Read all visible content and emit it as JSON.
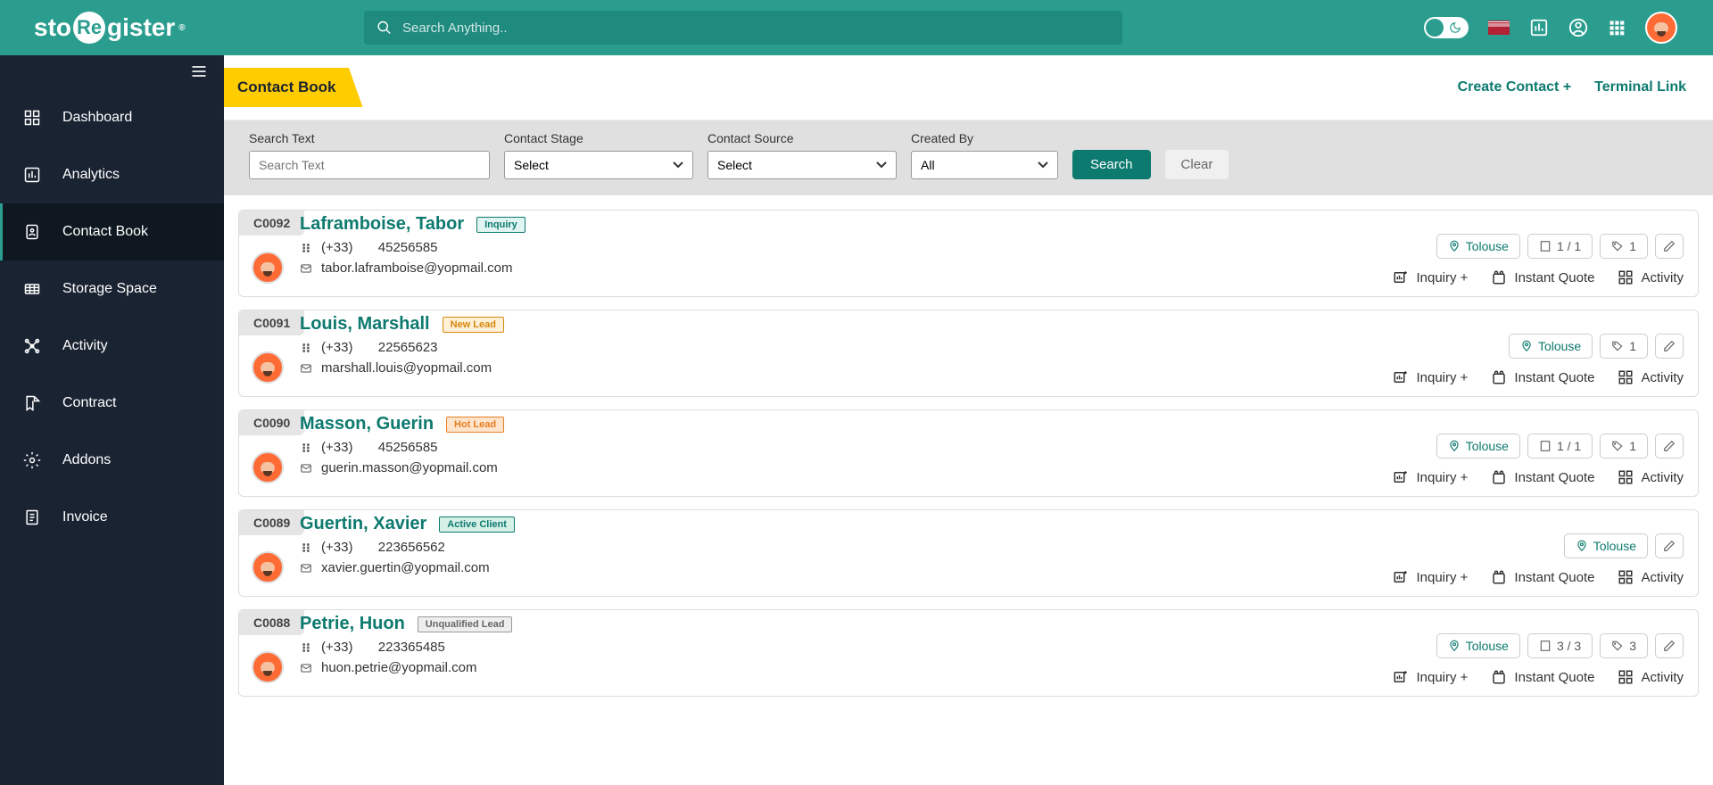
{
  "header": {
    "logo_pre": "sto",
    "logo_mid": "Re",
    "logo_post": "gister",
    "search_placeholder": "Search Anything.."
  },
  "sidebar": {
    "items": [
      {
        "label": "Dashboard",
        "icon": "dashboard-icon"
      },
      {
        "label": "Analytics",
        "icon": "analytics-icon"
      },
      {
        "label": "Contact Book",
        "icon": "contact-icon"
      },
      {
        "label": "Storage Space",
        "icon": "storage-icon"
      },
      {
        "label": "Activity",
        "icon": "activity-icon"
      },
      {
        "label": "Contract",
        "icon": "contract-icon"
      },
      {
        "label": "Addons",
        "icon": "addons-icon"
      },
      {
        "label": "Invoice",
        "icon": "invoice-icon"
      }
    ]
  },
  "page": {
    "title": "Contact Book",
    "create_link": "Create Contact +",
    "terminal_link": "Terminal Link"
  },
  "filters": {
    "search_label": "Search Text",
    "search_placeholder": "Search Text",
    "stage_label": "Contact Stage",
    "stage_value": "Select",
    "source_label": "Contact Source",
    "source_value": "Select",
    "created_label": "Created By",
    "created_value": "All",
    "search_btn": "Search",
    "clear_btn": "Clear"
  },
  "action_labels": {
    "inquiry": "Inquiry +",
    "quote": "Instant Quote",
    "activity": "Activity"
  },
  "contacts": [
    {
      "id": "C0092",
      "name": "Laframboise, Tabor",
      "stage": "Inquiry",
      "stage_class": "b-inquiry",
      "dial": "(+33)",
      "phone": "45256585",
      "email": "tabor.laframboise@yopmail.com",
      "chips": [
        {
          "t": "loc",
          "text": "Tolouse"
        },
        {
          "t": "building",
          "text": "1 / 1"
        },
        {
          "t": "tag",
          "text": "1"
        },
        {
          "t": "edit"
        }
      ]
    },
    {
      "id": "C0091",
      "name": "Louis, Marshall",
      "stage": "New Lead",
      "stage_class": "b-newlead",
      "dial": "(+33)",
      "phone": "22565623",
      "email": "marshall.louis@yopmail.com",
      "chips": [
        {
          "t": "loc",
          "text": "Tolouse"
        },
        {
          "t": "tag",
          "text": "1"
        },
        {
          "t": "edit"
        }
      ]
    },
    {
      "id": "C0090",
      "name": "Masson, Guerin",
      "stage": "Hot Lead",
      "stage_class": "b-hotlead",
      "dial": "(+33)",
      "phone": "45256585",
      "email": "guerin.masson@yopmail.com",
      "chips": [
        {
          "t": "loc",
          "text": "Tolouse"
        },
        {
          "t": "building",
          "text": "1 / 1"
        },
        {
          "t": "tag",
          "text": "1"
        },
        {
          "t": "edit"
        }
      ]
    },
    {
      "id": "C0089",
      "name": "Guertin, Xavier",
      "stage": "Active Client",
      "stage_class": "b-active",
      "dial": "(+33)",
      "phone": "223656562",
      "email": "xavier.guertin@yopmail.com",
      "chips": [
        {
          "t": "loc",
          "text": "Tolouse"
        },
        {
          "t": "edit"
        }
      ]
    },
    {
      "id": "C0088",
      "name": "Petrie, Huon",
      "stage": "Unqualified Lead",
      "stage_class": "b-unqual",
      "dial": "(+33)",
      "phone": "223365485",
      "email": "huon.petrie@yopmail.com",
      "chips": [
        {
          "t": "loc",
          "text": "Tolouse"
        },
        {
          "t": "building",
          "text": "3 / 3"
        },
        {
          "t": "tag",
          "text": "3"
        },
        {
          "t": "edit"
        }
      ]
    }
  ]
}
